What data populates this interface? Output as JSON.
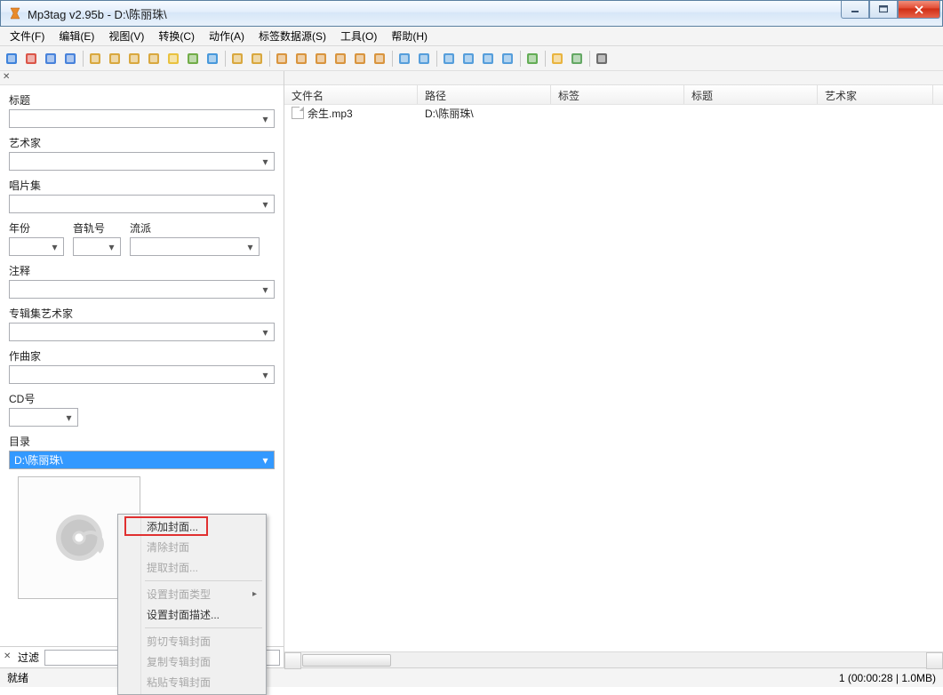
{
  "window": {
    "title": "Mp3tag v2.95b  -  D:\\陈丽珠\\"
  },
  "menu": {
    "items": [
      "文件(F)",
      "编辑(E)",
      "视图(V)",
      "转换(C)",
      "动作(A)",
      "标签数据源(S)",
      "工具(O)",
      "帮助(H)"
    ]
  },
  "sidebar": {
    "labels": {
      "title": "标题",
      "artist": "艺术家",
      "album": "唱片集",
      "year": "年份",
      "track": "音轨号",
      "genre": "流派",
      "comment": "注释",
      "albumartist": "专辑集艺术家",
      "composer": "作曲家",
      "discno": "CD号",
      "directory": "目录"
    },
    "values": {
      "title": "",
      "artist": "",
      "album": "",
      "year": "",
      "track": "",
      "genre": "",
      "comment": "",
      "albumartist": "",
      "composer": "",
      "discno": "",
      "directory": "D:\\陈丽珠\\"
    },
    "filter_label": "过滤"
  },
  "filelist": {
    "columns": [
      "文件名",
      "路径",
      "标签",
      "标题",
      "艺术家"
    ],
    "widths": [
      150,
      150,
      150,
      150,
      130
    ],
    "rows": [
      {
        "filename": "余生.mp3",
        "path": "D:\\陈丽珠\\",
        "tag": "",
        "title": "",
        "artist": ""
      }
    ]
  },
  "statusbar": {
    "ready": "就绪",
    "info": "1 (00:00:28 | 1.0MB)"
  },
  "contextmenu": {
    "items": [
      {
        "label": "添加封面...",
        "enabled": true
      },
      {
        "label": "清除封面",
        "enabled": false
      },
      {
        "label": "提取封面...",
        "enabled": false
      },
      {
        "sep": true
      },
      {
        "label": "设置封面类型",
        "enabled": false,
        "submenu": true
      },
      {
        "label": "设置封面描述...",
        "enabled": true
      },
      {
        "sep": true
      },
      {
        "label": "剪切专辑封面",
        "enabled": false
      },
      {
        "label": "复制专辑封面",
        "enabled": false
      },
      {
        "label": "粘贴专辑封面",
        "enabled": false
      }
    ]
  },
  "toolbar_icons": [
    {
      "name": "save-icon",
      "c": "#1e6fd6"
    },
    {
      "name": "delete-icon",
      "c": "#d63a2a"
    },
    {
      "name": "undo-icon",
      "c": "#2a6fd6"
    },
    {
      "name": "redo-icon",
      "c": "#2a6fd6"
    },
    {
      "sep": true
    },
    {
      "name": "folder-add-icon",
      "c": "#d49a1e"
    },
    {
      "name": "folder-open-icon",
      "c": "#d49a1e"
    },
    {
      "name": "folder-up-icon",
      "c": "#d49a1e"
    },
    {
      "name": "folder-fav-icon",
      "c": "#d49a1e"
    },
    {
      "name": "favorite-icon",
      "c": "#e6b81e"
    },
    {
      "name": "playlist-icon",
      "c": "#5aa02a"
    },
    {
      "name": "refresh-icon",
      "c": "#2a88d6"
    },
    {
      "sep": true
    },
    {
      "name": "tag-file-icon",
      "c": "#d49a1e"
    },
    {
      "name": "file-tag-icon",
      "c": "#d49a1e"
    },
    {
      "sep": true
    },
    {
      "name": "tag-src1-icon",
      "c": "#d4841e"
    },
    {
      "name": "tag-src2-icon",
      "c": "#d4841e"
    },
    {
      "name": "tag-src3-icon",
      "c": "#d4841e"
    },
    {
      "name": "tag-src4-icon",
      "c": "#d4841e"
    },
    {
      "name": "tag-src5-icon",
      "c": "#d4841e"
    },
    {
      "name": "tag-src6-icon",
      "c": "#d4841e"
    },
    {
      "sep": true
    },
    {
      "name": "autonum-icon",
      "c": "#3a8ed6"
    },
    {
      "name": "case-icon",
      "c": "#3a8ed6"
    },
    {
      "sep": true
    },
    {
      "name": "actions-icon",
      "c": "#3a8ed6"
    },
    {
      "name": "quick-action-icon",
      "c": "#3a8ed6"
    },
    {
      "name": "export-icon",
      "c": "#3a8ed6"
    },
    {
      "name": "columns-icon",
      "c": "#3a8ed6"
    },
    {
      "sep": true
    },
    {
      "name": "check-icon",
      "c": "#4aa03a"
    },
    {
      "sep": true
    },
    {
      "name": "web-icon",
      "c": "#e6a81e"
    },
    {
      "name": "globe-icon",
      "c": "#4a9a4a"
    },
    {
      "sep": true
    },
    {
      "name": "settings-icon",
      "c": "#555"
    }
  ]
}
